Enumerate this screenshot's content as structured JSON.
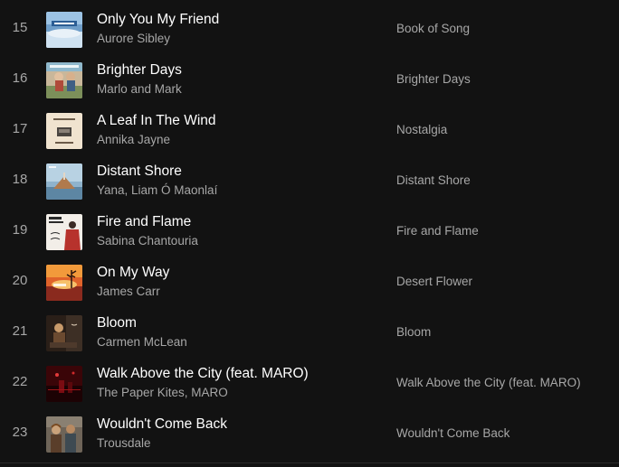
{
  "tracks": [
    {
      "number": "15",
      "title": "Only You My Friend",
      "artist": "Aurore Sibley",
      "album": "Book of Song",
      "cover": "book-of-song-cover"
    },
    {
      "number": "16",
      "title": "Brighter Days",
      "artist": "Marlo and Mark",
      "album": "Brighter Days",
      "cover": "brighter-days-cover"
    },
    {
      "number": "17",
      "title": "A Leaf In The Wind",
      "artist": "Annika Jayne",
      "album": "Nostalgia",
      "cover": "nostalgia-cover"
    },
    {
      "number": "18",
      "title": "Distant Shore",
      "artist": "Yana, Liam Ó Maonlaí",
      "album": "Distant Shore",
      "cover": "distant-shore-cover"
    },
    {
      "number": "19",
      "title": "Fire and Flame",
      "artist": "Sabina Chantouria",
      "album": "Fire and Flame",
      "cover": "fire-and-flame-cover"
    },
    {
      "number": "20",
      "title": "On My Way",
      "artist": "James Carr",
      "album": "Desert Flower",
      "cover": "desert-flower-cover"
    },
    {
      "number": "21",
      "title": "Bloom",
      "artist": "Carmen McLean",
      "album": "Bloom",
      "cover": "bloom-cover"
    },
    {
      "number": "22",
      "title": "Walk Above the City (feat. MARO)",
      "artist": "The Paper Kites, MARO",
      "album": "Walk Above the City (feat. MARO)",
      "cover": "walk-above-the-city-cover"
    },
    {
      "number": "23",
      "title": "Wouldn't Come Back",
      "artist": "Trousdale",
      "album": "Wouldn't Come Back",
      "cover": "wouldnt-come-back-cover"
    }
  ],
  "colors": {
    "background": "#121212",
    "title_text": "#ffffff",
    "secondary_text": "#a7a7a7"
  }
}
